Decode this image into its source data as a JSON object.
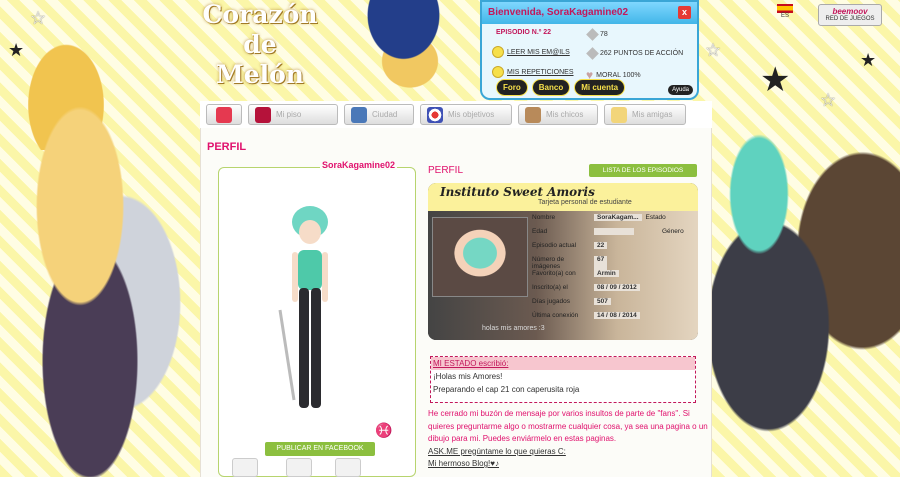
{
  "site": {
    "logo_lines": [
      "Corazón",
      "de",
      "Melón"
    ]
  },
  "user_panel": {
    "welcome": "Bienvenida, SoraKagamine02",
    "episode_label": "EPISODIO N.º 22",
    "mails_link": "LEER MIS EM@ILS",
    "repeats_link": "MIS REPETICIONES",
    "gems": "78",
    "action_points": "262 PUNTOS DE ACCIÓN",
    "moral": "MORAL 100%",
    "buttons": [
      "Foro",
      "Banco",
      "Mi cuenta"
    ],
    "help": "Ayuda",
    "close": "x"
  },
  "language": {
    "code": "ES"
  },
  "network": {
    "name": "beemoov",
    "label": "RED DE JUEGOS"
  },
  "nav": {
    "tabs": [
      {
        "label": "",
        "icon": "home-icon"
      },
      {
        "label": "Mi piso",
        "icon": "sofa-icon"
      },
      {
        "label": "Ciudad",
        "icon": "city-icon"
      },
      {
        "label": "Mis objetivos",
        "icon": "target-icon"
      },
      {
        "label": "Mis chicos",
        "icon": "boy-icon"
      },
      {
        "label": "Mis amigas",
        "icon": "girl-icon"
      }
    ]
  },
  "profile": {
    "title": "PERFIL",
    "username": "SoraKagamine02",
    "facebook_button": "PUBLICAR EN FACEBOOK",
    "zodiac_symbol": "♓"
  },
  "card_section": {
    "title": "PERFIL",
    "episodes_button": "LISTA DE LOS EPISODIOS",
    "card_title": "Instituto Sweet Amoris",
    "card_subtitle": "Tarjeta personal de estudiante",
    "rows": [
      {
        "label": "Nombre",
        "value": "SoraKagam..."
      },
      {
        "label": "Edad",
        "value": ""
      },
      {
        "label": "Episodio actual",
        "value": "22"
      },
      {
        "label": "Número de imágenes",
        "value": "67"
      },
      {
        "label": "Favorito(a) con",
        "value": "Armin"
      },
      {
        "label": "Inscrito(a) el",
        "value": "08 / 09 / 2012"
      },
      {
        "label": "Días jugados",
        "value": "507"
      },
      {
        "label": "Última conexión",
        "value": "14 / 08 / 2014"
      }
    ],
    "extra_labels": {
      "estado": "Estado",
      "genero": "Género"
    },
    "footer": "holas mis amores :3"
  },
  "status": {
    "header": "MI ESTADO escribió:",
    "lines": [
      "¡Holas mis Amores!",
      "Preparando el cap 21 con caperusita roja"
    ]
  },
  "bio": {
    "text": "He cerrado mi buzón de mensaje por varios insultos de parte de \"fans\". Si quieres preguntarme algo o mostrarme cualquier cosa, ya sea una pagina o un dibujo para mi. Puedes enviármelo en estas paginas.",
    "link1": "ASK.ME pregúntame lo que quieras C:",
    "link2": "Mi hermoso Blog!♥♪"
  },
  "colors": {
    "accent": "#e0116d",
    "green": "#8cbf3f",
    "panel_blue": "#42b6e8"
  }
}
